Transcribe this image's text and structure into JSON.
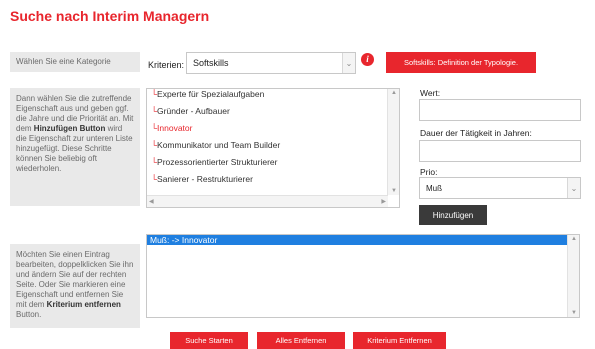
{
  "page": {
    "title": "Suche nach Interim Managern"
  },
  "category_panel": {
    "text": "Wählen Sie eine Kategorie"
  },
  "criteria": {
    "label": "Kriterien:",
    "selected": "Softskills",
    "info_icon": "info-icon",
    "definition_button": "Softskills: Definition der Typologie."
  },
  "instructions_panel": {
    "text_before": "Dann wählen Sie die zutreffende Eigenschaft aus und geben ggf. die Jahre und die Priorität an. Mit dem ",
    "bold": "Hinzufügen Button",
    "text_after": " wird die Eigenschaft zur unteren Liste hinzugefügt. Diese Schritte können Sie beliebig oft wiederholen."
  },
  "properties_list": {
    "items": [
      {
        "label": "Experte für Spezialaufgaben",
        "highlight": false
      },
      {
        "label": "Gründer - Aufbauer",
        "highlight": false
      },
      {
        "label": "Innovator",
        "highlight": true
      },
      {
        "label": "Kommunikator und Team Builder",
        "highlight": false
      },
      {
        "label": "Prozessorientierter Strukturierer",
        "highlight": false
      },
      {
        "label": "Sanierer - Restrukturierer",
        "highlight": false
      }
    ]
  },
  "form": {
    "wert_label": "Wert:",
    "wert_value": "",
    "dauer_label": "Dauer der Tätigkeit in Jahren:",
    "dauer_value": "",
    "prio_label": "Prio:",
    "prio_selected": "Muß",
    "add_button": "Hinzufügen"
  },
  "edit_panel": {
    "text_before": "Möchten Sie einen Eintrag bearbeiten, doppelklicken Sie ihn und ändern Sie auf der rechten Seite. Oder Sie markieren eine Eigenschaft und entfernen Sie mit dem ",
    "bold": "Kriterium entfernen",
    "text_after": " Button."
  },
  "entries_list": {
    "items": [
      "Muß: -> Innovator"
    ]
  },
  "actions": {
    "search": "Suche Starten",
    "remove_all": "Alles Entfernen",
    "remove_criterion": "Kriterium Entfernen"
  },
  "colors": {
    "accent": "#e8262d",
    "selection": "#1f7fe0",
    "panel": "#e9e9e9"
  }
}
